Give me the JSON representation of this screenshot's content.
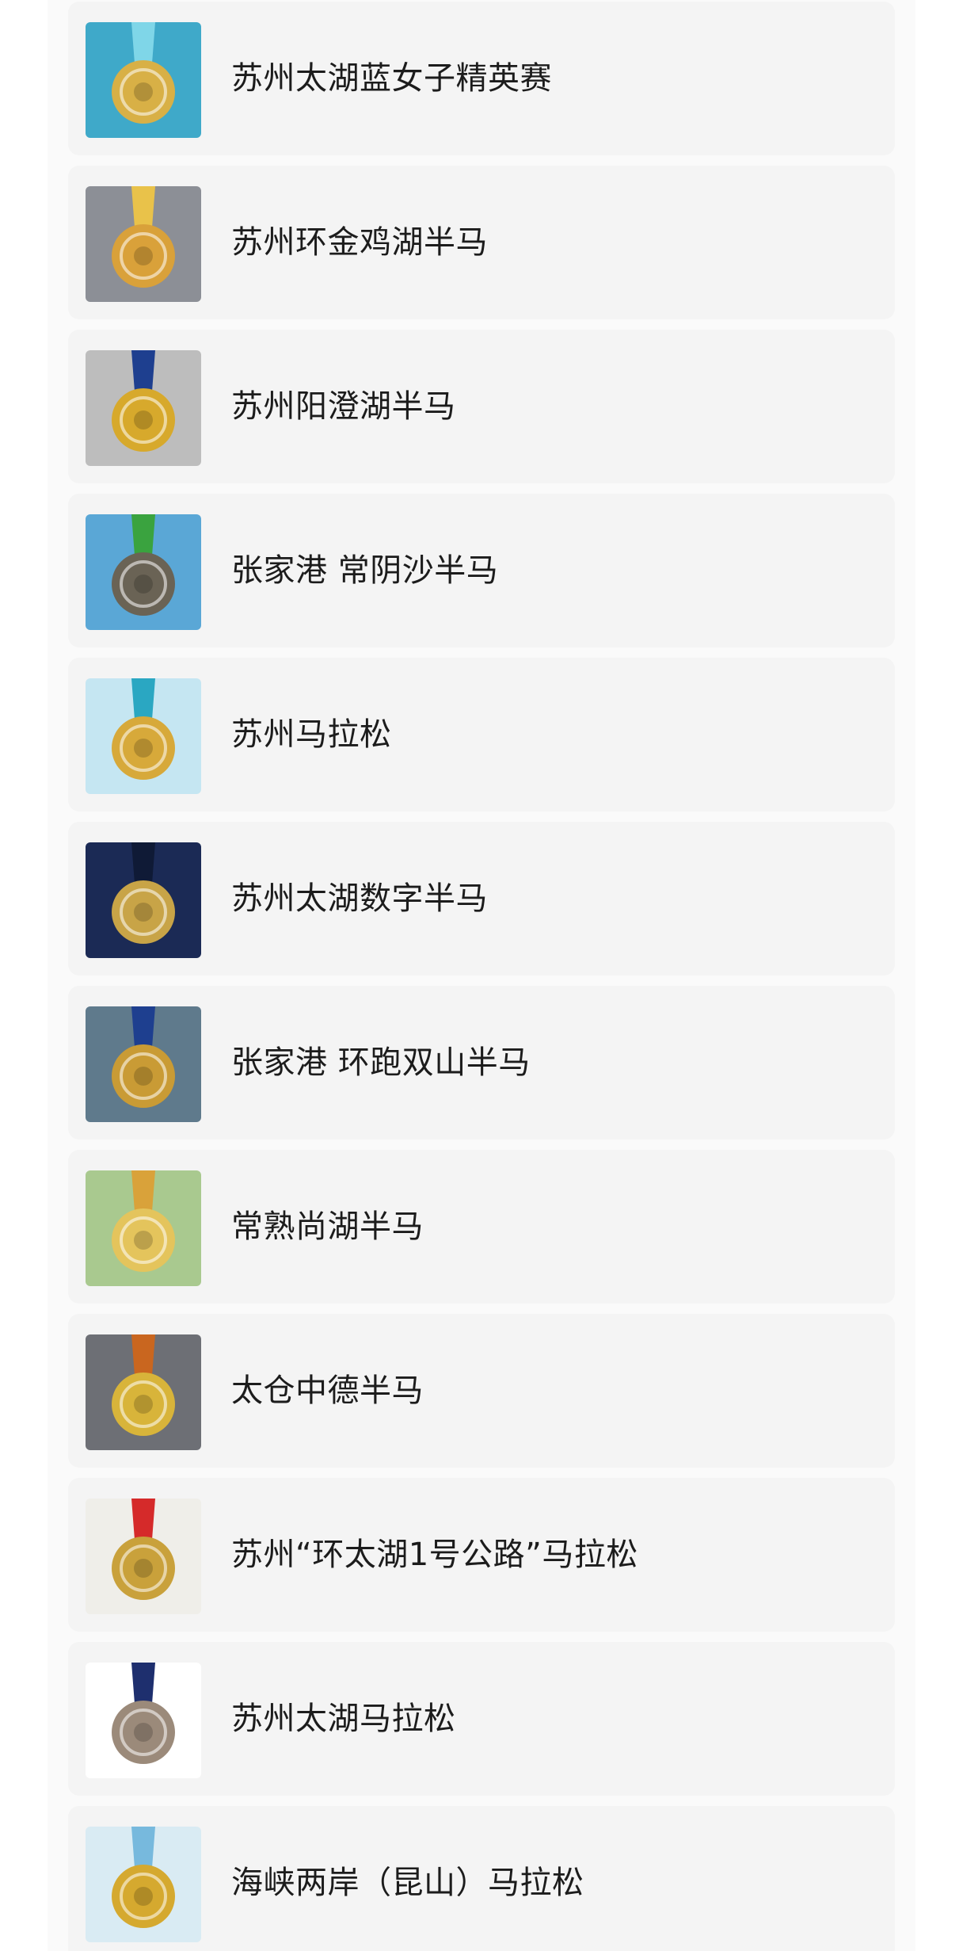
{
  "races": [
    {
      "name": "苏州太湖蓝女子精英赛",
      "thumbnail_icon": "medal-icon",
      "palette": {
        "bg": "#3fa9c9",
        "ribbon": "#7fd6e8",
        "medal": "#d8b046"
      }
    },
    {
      "name": "苏州环金鸡湖半马",
      "thumbnail_icon": "medal-icon",
      "palette": {
        "bg": "#8c8f96",
        "ribbon": "#e9c24a",
        "medal": "#d9a13a"
      }
    },
    {
      "name": "苏州阳澄湖半马",
      "thumbnail_icon": "medal-icon",
      "palette": {
        "bg": "#bdbdbd",
        "ribbon": "#1e3f8f",
        "medal": "#d7a92c"
      }
    },
    {
      "name": "张家港 常阴沙半马",
      "thumbnail_icon": "medal-icon",
      "palette": {
        "bg": "#5aa7d6",
        "ribbon": "#3aa33f",
        "medal": "#6a6355"
      }
    },
    {
      "name": "苏州马拉松",
      "thumbnail_icon": "medal-icon",
      "palette": {
        "bg": "#c5e6f2",
        "ribbon": "#2aa7c2",
        "medal": "#d7a93a"
      }
    },
    {
      "name": "苏州太湖数字半马",
      "thumbnail_icon": "medal-icon",
      "palette": {
        "bg": "#1b2a55",
        "ribbon": "#0f1a36",
        "medal": "#c8a447"
      }
    },
    {
      "name": "张家港 环跑双山半马",
      "thumbnail_icon": "medal-icon",
      "palette": {
        "bg": "#5f7a8c",
        "ribbon": "#1e3f8f",
        "medal": "#c99b35"
      }
    },
    {
      "name": "常熟尚湖半马",
      "thumbnail_icon": "medal-icon",
      "palette": {
        "bg": "#a9c98f",
        "ribbon": "#d9a23a",
        "medal": "#e4c45c"
      }
    },
    {
      "name": "太仓中德半马",
      "thumbnail_icon": "medal-icon",
      "palette": {
        "bg": "#6d6f75",
        "ribbon": "#c9661f",
        "medal": "#d8b43a"
      }
    },
    {
      "name": "苏州“环太湖1号公路”马拉松",
      "thumbnail_icon": "medal-icon",
      "palette": {
        "bg": "#efeee9",
        "ribbon": "#d52a2a",
        "medal": "#c9a13b"
      }
    },
    {
      "name": "苏州太湖马拉松",
      "thumbnail_icon": "medal-icon",
      "palette": {
        "bg": "#ffffff",
        "ribbon": "#1e2f6e",
        "medal": "#9b8a7a"
      }
    },
    {
      "name": "海峡两岸（昆山）马拉松",
      "thumbnail_icon": "medal-icon",
      "palette": {
        "bg": "#d9ebf3",
        "ribbon": "#77b9dd",
        "medal": "#d5a92f"
      }
    }
  ]
}
